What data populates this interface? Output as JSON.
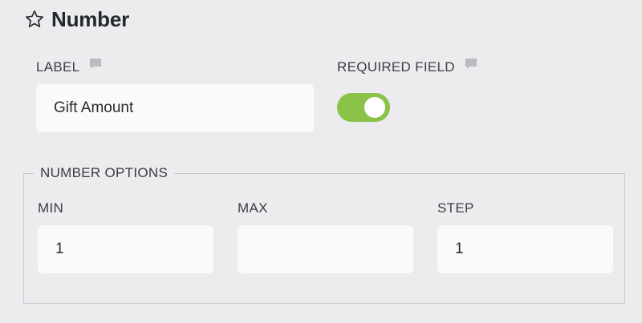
{
  "header": {
    "title": "Number",
    "icon": "star-outline-icon"
  },
  "label_field": {
    "label": "LABEL",
    "value": "Gift Amount",
    "help_icon": "comment-icon"
  },
  "required_field": {
    "label": "REQUIRED FIELD",
    "enabled": true,
    "help_icon": "comment-icon",
    "toggle_color": "#8bc34a"
  },
  "number_options": {
    "legend": "NUMBER OPTIONS",
    "min": {
      "label": "MIN",
      "value": "1"
    },
    "max": {
      "label": "MAX",
      "value": ""
    },
    "step": {
      "label": "STEP",
      "value": "1"
    }
  }
}
